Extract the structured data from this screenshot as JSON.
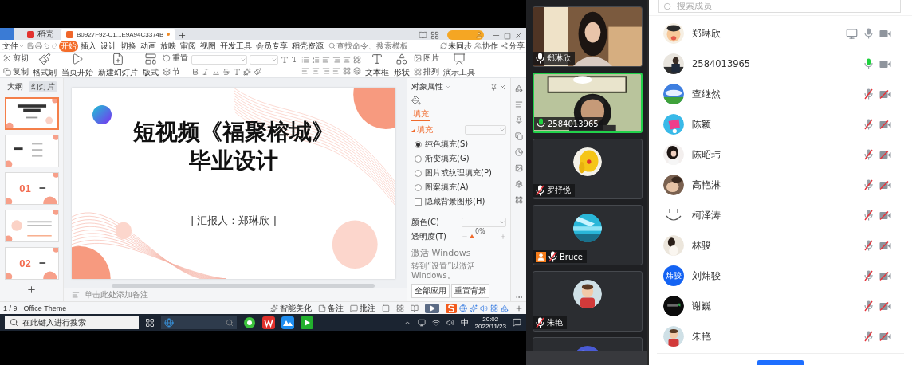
{
  "wps": {
    "tabs": [
      {
        "label": "稻壳",
        "selected": false
      },
      {
        "label": "B0927F92-C1...E9A94C3374B",
        "selected": true
      }
    ],
    "menu_tabs": [
      {
        "label": "文件",
        "selected": false
      },
      {
        "label": "开始",
        "selected": true
      },
      {
        "label": "插入",
        "selected": false
      },
      {
        "label": "设计",
        "selected": false
      },
      {
        "label": "切换",
        "selected": false
      },
      {
        "label": "动画",
        "selected": false
      },
      {
        "label": "放映",
        "selected": false
      },
      {
        "label": "审阅",
        "selected": false
      },
      {
        "label": "视图",
        "selected": false
      },
      {
        "label": "开发工具",
        "selected": false
      },
      {
        "label": "会员专享",
        "selected": false
      },
      {
        "label": "稻壳资源",
        "selected": false
      }
    ],
    "command_search": {
      "placeholder": "查找命令、搜索模板"
    },
    "actions": [
      "未同步",
      "协作",
      "分享"
    ],
    "toolbar": [
      {
        "kind": "stack",
        "items": [
          "剪切",
          "复制"
        ]
      },
      {
        "kind": "big",
        "label": "格式刷"
      },
      {
        "kind": "big",
        "label": "当页开始"
      },
      {
        "kind": "big",
        "label": "新建幻灯片"
      },
      {
        "kind": "big",
        "label": "版式"
      },
      {
        "kind": "stack",
        "items": [
          "重置",
          "节"
        ]
      },
      {
        "kind": "font"
      },
      {
        "kind": "paragraph"
      },
      {
        "kind": "big",
        "label": "文本框"
      },
      {
        "kind": "big",
        "label": "形状"
      },
      {
        "kind": "stack",
        "items": [
          "图片",
          "排列"
        ]
      },
      {
        "kind": "big",
        "label": "演示工具"
      }
    ],
    "panel_tabs": [
      {
        "label": "大纲",
        "selected": false
      },
      {
        "label": "幻灯片",
        "selected": true
      }
    ],
    "thumbnails": [
      {
        "kind": "title",
        "selected": true
      },
      {
        "kind": "contents",
        "selected": false
      },
      {
        "kind": "section",
        "number": "01",
        "selected": false
      },
      {
        "kind": "text",
        "selected": false
      },
      {
        "kind": "section",
        "number": "02",
        "selected": false
      }
    ],
    "slide": {
      "title_line1": "短视频《福聚榕城》",
      "title_line2": "毕业设计",
      "presenter": "| 汇报人：郑琳欣 |"
    },
    "notes_placeholder": "单击此处添加备注",
    "properties": {
      "title": "对象属性",
      "tab": "填充",
      "section": "填充",
      "options": [
        {
          "label": "纯色填充(S)",
          "kind": "radio",
          "selected": true
        },
        {
          "label": "渐变填充(G)",
          "kind": "radio",
          "selected": false
        },
        {
          "label": "图片或纹理填充(P)",
          "kind": "radio",
          "selected": false
        },
        {
          "label": "图案填充(A)",
          "kind": "radio",
          "selected": false
        },
        {
          "label": "隐藏背景图形(H)",
          "kind": "checkbox",
          "checked": false
        }
      ],
      "color_label": "颜色(C)",
      "transparency_label": "透明度(T)",
      "transparency_value": "0%",
      "transparency": {
        "level": 0
      },
      "watermark": [
        "激活 Windows",
        "转到“设置”以激活 Windows。"
      ],
      "buttons": [
        "全部应用",
        "重置背景"
      ]
    },
    "status": {
      "slide_counter": "1 / 9",
      "theme": "Office Theme",
      "buttons": [
        "智能美化",
        "备注",
        "批注"
      ]
    }
  },
  "taskbar": {
    "search_placeholder": "在此键入进行搜索",
    "ime": "中",
    "time": "20:02",
    "date": "2022/11/23"
  },
  "videos": [
    {
      "name": "郑琳欣",
      "muted": false,
      "speaking": false,
      "camera": true,
      "highlighted": false,
      "badge": false
    },
    {
      "name": "2584013965",
      "muted": false,
      "speaking": true,
      "camera": true,
      "highlighted": true,
      "badge": false
    },
    {
      "name": "罗抒悦",
      "muted": true,
      "speaking": false,
      "camera": false,
      "highlighted": false,
      "badge": false
    },
    {
      "name": "Bruce",
      "muted": true,
      "speaking": false,
      "camera": false,
      "highlighted": false,
      "badge": true
    },
    {
      "name": "朱艳",
      "muted": true,
      "speaking": false,
      "camera": false,
      "highlighted": false,
      "badge": false
    }
  ],
  "members": {
    "search_placeholder": "搜索成员",
    "items": [
      {
        "name": "郑琳欣",
        "sharing": true,
        "muted": false,
        "speaking": false,
        "camera": true
      },
      {
        "name": "2584013965",
        "sharing": false,
        "muted": false,
        "speaking": true,
        "camera": true
      },
      {
        "name": "查继然",
        "sharing": false,
        "muted": true,
        "speaking": false,
        "camera": false
      },
      {
        "name": "陈颖",
        "sharing": false,
        "muted": true,
        "speaking": false,
        "camera": false
      },
      {
        "name": "陈昭玮",
        "sharing": false,
        "muted": true,
        "speaking": false,
        "camera": false
      },
      {
        "name": "高艳淋",
        "sharing": false,
        "muted": true,
        "speaking": false,
        "camera": false
      },
      {
        "name": "柯泽涛",
        "avatar": {
          "kind": "smiley"
        },
        "sharing": false,
        "muted": true,
        "speaking": false,
        "camera": false
      },
      {
        "name": "林骏",
        "sharing": false,
        "muted": true,
        "speaking": false,
        "camera": false
      },
      {
        "name": "刘炜骏",
        "avatar": {
          "kind": "text",
          "text": "炜骏"
        },
        "sharing": false,
        "muted": true,
        "speaking": false,
        "camera": false
      },
      {
        "name": "谢巍",
        "sharing": false,
        "muted": true,
        "speaking": false,
        "camera": false
      },
      {
        "name": "朱艳",
        "sharing": false,
        "muted": true,
        "speaking": false,
        "camera": false
      }
    ]
  }
}
